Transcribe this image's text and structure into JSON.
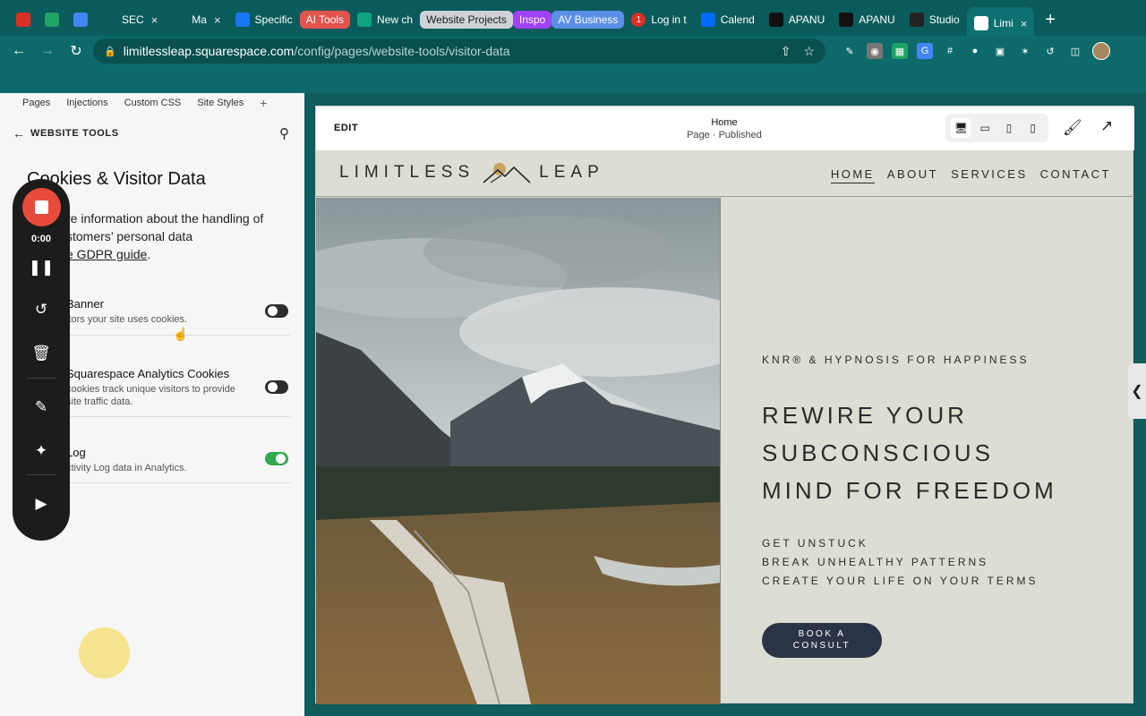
{
  "browser": {
    "tabs": [
      {
        "label": "",
        "icon": "gmail-icon",
        "color": "#d93025"
      },
      {
        "label": "",
        "icon": "drive-icon",
        "color": "#1fa463"
      },
      {
        "label": "",
        "icon": "calendar-icon",
        "color": "#4285f4"
      },
      {
        "label": "SEC",
        "icon": "dot-icon",
        "color": "#0a5b5b",
        "close": "×"
      },
      {
        "label": "Ma",
        "icon": "dot-icon",
        "color": "#0a5b5b",
        "close": "×"
      },
      {
        "label": "Specific",
        "icon": "meta-icon",
        "color": "#1877f2"
      },
      {
        "label": "AI Tools",
        "pill": "#e0544d"
      },
      {
        "label": "New ch",
        "icon": "chatgpt-icon",
        "color": "#10a37f"
      },
      {
        "label": "Website Projects",
        "pill": "#cfd3d6",
        "pill_text": "#222"
      },
      {
        "label": "Inspo",
        "pill": "#a142f4"
      },
      {
        "label": "AV Business",
        "pill": "#5b8ee6"
      },
      {
        "label": "Log in t",
        "icon": "badge-icon",
        "color": "#d93025",
        "badge": "1"
      },
      {
        "label": "Calend",
        "icon": "calendly-icon",
        "color": "#006bff"
      },
      {
        "label": "APANU",
        "icon": "triangle-icon",
        "color": "#111"
      },
      {
        "label": "APANU",
        "icon": "triangle-icon",
        "color": "#111"
      },
      {
        "label": "Studio",
        "icon": "studio-icon",
        "color": "#222"
      },
      {
        "label": "Limi",
        "icon": "squarespace-icon",
        "color": "#fff",
        "active": true,
        "close": "×"
      }
    ],
    "new_tab": "+",
    "url_host": "limitlessleap.squarespace.com",
    "url_path": "/config/pages/website-tools/visitor-data"
  },
  "panel": {
    "subtabs": [
      "Pages",
      "Injections",
      "Custom CSS",
      "Site Styles"
    ],
    "subtab_add": "+",
    "section_label": "WEBSITE TOOLS",
    "title": "Cookies & Visitor Data",
    "desc_pre": "re information about the handling of",
    "desc_mid": "stomers’ personal data",
    "desc_link": "e GDPR guide",
    "desc_end": ".",
    "settings": [
      {
        "title": "Banner",
        "desc": "itors your site uses cookies.",
        "on": false
      },
      {
        "title": "Squarespace Analytics Cookies",
        "desc": "cookies track unique visitors to provide site traffic data.",
        "on": false
      },
      {
        "title": "Log",
        "desc": "ctivity Log data in Analytics.",
        "on": true
      }
    ]
  },
  "recorder": {
    "time": "0:00",
    "accent": "#e84b3c"
  },
  "preview": {
    "edit_label": "EDIT",
    "page_title": "Home",
    "page_status": "Page · Published",
    "site": {
      "logo_left": "LIMITLESS",
      "logo_right": "LEAP",
      "nav": [
        "HOME",
        "ABOUT",
        "SERVICES",
        "CONTACT"
      ],
      "eyebrow": "KNR® & HYPNOSIS FOR HAPPINESS",
      "headline": [
        "REWIRE YOUR",
        "SUBCONSCIOUS",
        "MIND FOR FREEDOM"
      ],
      "bullets": [
        "GET UNSTUCK",
        "BREAK UNHEALTHY PATTERNS",
        "CREATE YOUR LIFE ON YOUR TERMS"
      ],
      "cta_line1": "BOOK A",
      "cta_line2": "CONSULT"
    }
  },
  "colors": {
    "browser_chrome": "#0a5b5b",
    "site_bg": "#dcddd3",
    "cta_bg": "#2b3447",
    "toggle_on": "#2fa84f"
  }
}
